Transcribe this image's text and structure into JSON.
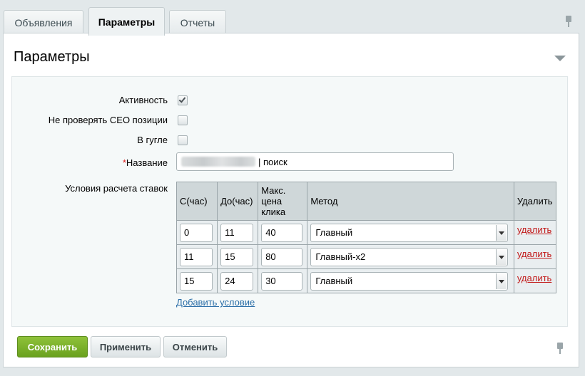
{
  "tabs": [
    {
      "label": "Объявления",
      "active": false
    },
    {
      "label": "Параметры",
      "active": true
    },
    {
      "label": "Отчеты",
      "active": false
    }
  ],
  "section": {
    "title": "Параметры"
  },
  "fields": {
    "activity": {
      "label": "Активность",
      "checked": true
    },
    "no_seo_check": {
      "label": "Не проверять СЕО позиции",
      "checked": false
    },
    "in_google": {
      "label": "В гугле",
      "checked": false
    },
    "name": {
      "required_mark": "*",
      "label": "Название",
      "value_suffix": "| поиск"
    }
  },
  "conditions": {
    "label": "Условия расчета ставок",
    "columns": {
      "from": "С(час)",
      "to": "До(час)",
      "max_price": "Макс. цена клика",
      "method": "Метод",
      "delete": "Удалить"
    },
    "rows": [
      {
        "from": "0",
        "to": "11",
        "max_price": "40",
        "method": "Главный",
        "delete": "удалить"
      },
      {
        "from": "11",
        "to": "15",
        "max_price": "80",
        "method": "Главный-x2",
        "delete": "удалить"
      },
      {
        "from": "15",
        "to": "24",
        "max_price": "30",
        "method": "Главный",
        "delete": "удалить"
      }
    ],
    "add_link": "Добавить условие"
  },
  "buttons": {
    "save": "Сохранить",
    "apply": "Применить",
    "cancel": "Отменить"
  },
  "colors": {
    "save_button": "#7ab32e",
    "delete_link": "#c21a1a",
    "add_link": "#2c6fa8",
    "required_mark": "#e02020"
  }
}
